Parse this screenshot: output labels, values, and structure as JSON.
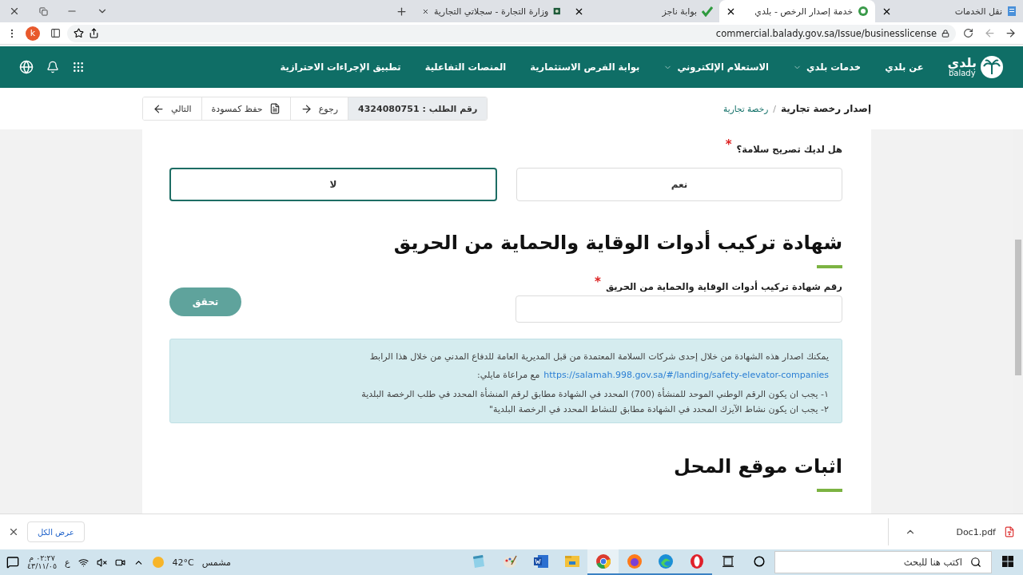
{
  "browser": {
    "tabs": [
      {
        "title": "نقل الخدمات",
        "selected": false
      },
      {
        "title": "خدمة إصدار الرخص - بلدي",
        "selected": true
      },
      {
        "title": "بوابة ناجز",
        "selected": false
      },
      {
        "title": "وزارة التجارة - سجلاتي التجارية",
        "selected": false
      }
    ],
    "url": "commercial.balady.gov.sa/Issue/businesslicense",
    "profile_initial": "k"
  },
  "nav": {
    "logo": {
      "arabic": "بلدي",
      "latin": "balady"
    },
    "items": [
      {
        "label": "عن بلدي",
        "has_menu": false
      },
      {
        "label": "خدمات بلدي",
        "has_menu": true
      },
      {
        "label": "الاستعلام الإلكتروني",
        "has_menu": true
      },
      {
        "label": "بوابة الفرص الاستثمارية",
        "has_menu": false
      },
      {
        "label": "المنصات التفاعلية",
        "has_menu": false
      },
      {
        "label": "تطبيق الإجراءات الاحترازية",
        "has_menu": false
      }
    ]
  },
  "breadcrumb": {
    "current": "إصدار رخصة تجارية",
    "separator": "/",
    "parent": "رخصة تجارية"
  },
  "toolbar": {
    "request_number": "رقم الطلب : 4324080751",
    "back": "رجوع",
    "save_draft": "حفظ كمسودة",
    "next": "التالي"
  },
  "safety_question": {
    "label": "هل لديك تصريح سلامة؟",
    "required_mark": "*",
    "options": [
      {
        "label": "نعم",
        "selected": false
      },
      {
        "label": "لا",
        "selected": true
      }
    ]
  },
  "certificate_section": {
    "title": "شهادة تركيب أدوات الوقاية والحماية من الحريق",
    "field_label": "رقم شهادة تركيب أدوات الوقاية والحماية من الحريق",
    "required_mark": "*",
    "verify_button": "تحقق",
    "notes": {
      "intro": "يمكنك اصدار هذه الشهادة من خلال إحدى شركات السلامة المعتمدة من قبل المديرية العامة للدفاع المدني من خلال هذا الرابط",
      "link": "https://salamah.998.gov.sa/#/landing/safety-elevator-companies",
      "after_link": "مع مراعاة مايلي:",
      "items": [
        "١- يجب ان يكون الرقم الوطني الموحد للمنشأة (700) المحدد في الشهادة مطابق لرقم المنشأة المحدد في طلب الرخصة البلدية",
        "٢- يجب ان يكون نشاط الآيزك المحدد في الشهادة مطابق للنشاط المحدد في الرخصة البلدية\""
      ]
    }
  },
  "location_section": {
    "title": "اثبات موقع المحل"
  },
  "downloads": {
    "file": "Doc1.pdf",
    "show_all": "عرض الكل"
  },
  "taskbar": {
    "search_placeholder": "اكتب هنا للبحث",
    "apps": [
      {
        "kind": "taskview",
        "running": false,
        "selected": false
      },
      {
        "kind": "opera",
        "running": true,
        "selected": false
      },
      {
        "kind": "edge",
        "running": true,
        "selected": false
      },
      {
        "kind": "firefox",
        "running": true,
        "selected": false
      },
      {
        "kind": "chrome",
        "running": true,
        "selected": true
      },
      {
        "kind": "explorer",
        "running": false,
        "selected": false
      },
      {
        "kind": "word",
        "running": false,
        "selected": false
      },
      {
        "kind": "paint",
        "running": false,
        "selected": false
      },
      {
        "kind": "notepad",
        "running": false,
        "selected": false
      }
    ],
    "weather_text": "مشمس",
    "temperature": "42°C",
    "language": "ع",
    "time": "٠٢:٢٧ م",
    "date": "٤٣/١١/٠٥"
  }
}
